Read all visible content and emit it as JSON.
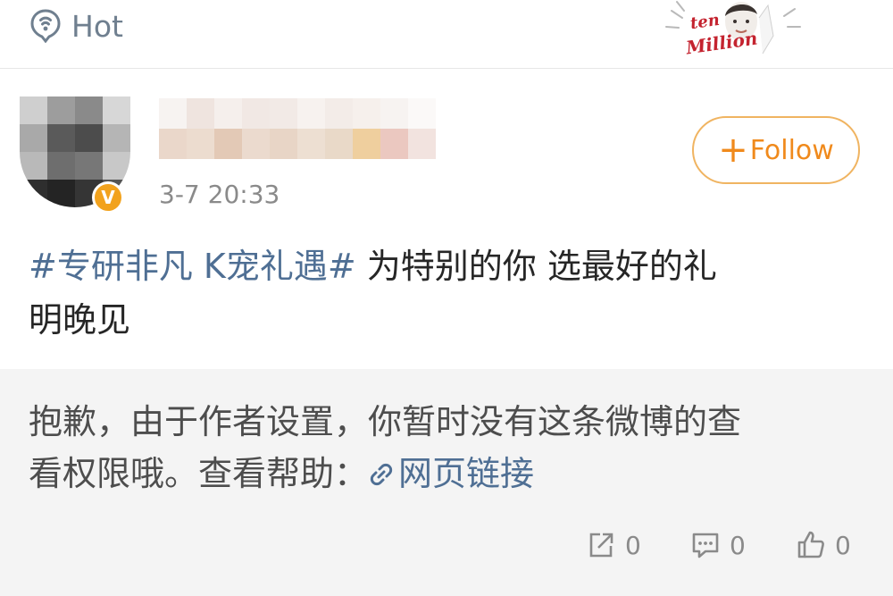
{
  "header": {
    "section_label": "Hot",
    "promo": {
      "line1": "ten",
      "line2": "Million",
      "accent": "#c4232f"
    }
  },
  "post": {
    "timestamp": "3-7 20:33",
    "verified_mark": "V",
    "follow_label": "Follow",
    "follow_plus": "+",
    "hashtag": "#专研非凡 K宠礼遇#",
    "text_line1": " 为特别的你 选最好的礼",
    "text_line2": "明晚见"
  },
  "notice": {
    "text_line1": "抱歉，由于作者设置，你暂时没有这条微博的查",
    "text_line2": "看权限哦。查看帮助：",
    "link_label": "网页链接"
  },
  "actions": {
    "repost_count": "0",
    "comment_count": "0",
    "like_count": "0"
  },
  "colors": {
    "accent_orange": "#f08a1c",
    "link_blue": "#4f6f94",
    "verified": "#f2a21d",
    "notice_bg": "#f4f4f4"
  },
  "icons": [
    "hot-icon",
    "link-icon",
    "repost-icon",
    "comment-icon",
    "like-icon"
  ]
}
